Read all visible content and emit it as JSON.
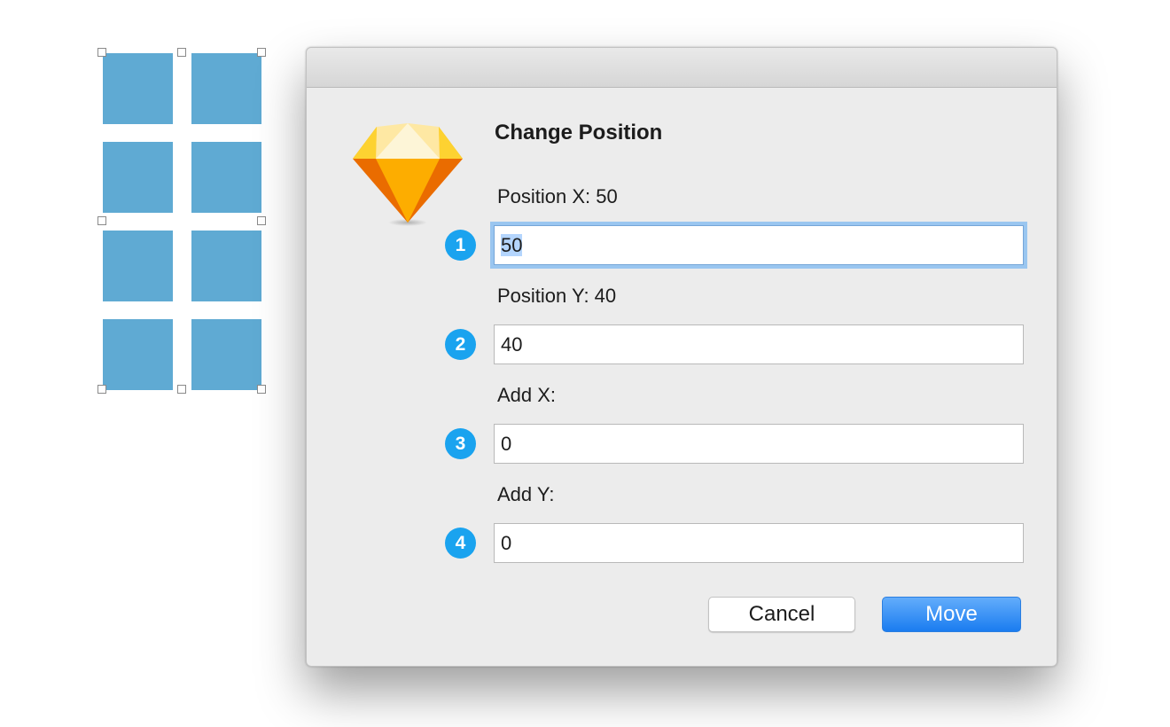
{
  "dialog": {
    "title": "Change Position",
    "fields": [
      {
        "badge": "1",
        "label": "Position X: 50",
        "value": "50",
        "focused": true
      },
      {
        "badge": "2",
        "label": "Position Y: 40",
        "value": "40"
      },
      {
        "badge": "3",
        "label": "Add X:",
        "value": "0"
      },
      {
        "badge": "4",
        "label": "Add Y:",
        "value": "0"
      }
    ],
    "buttons": {
      "cancel_label": "Cancel",
      "primary_label": "Move"
    }
  },
  "icons": {
    "app": "sketch-diamond-icon"
  },
  "colors": {
    "tile": "#5faad3",
    "badge": "#1aa3ef",
    "accent": "#1a7cf0",
    "focus_ring": "#9ac6f0",
    "dialog_bg": "#ececec"
  }
}
